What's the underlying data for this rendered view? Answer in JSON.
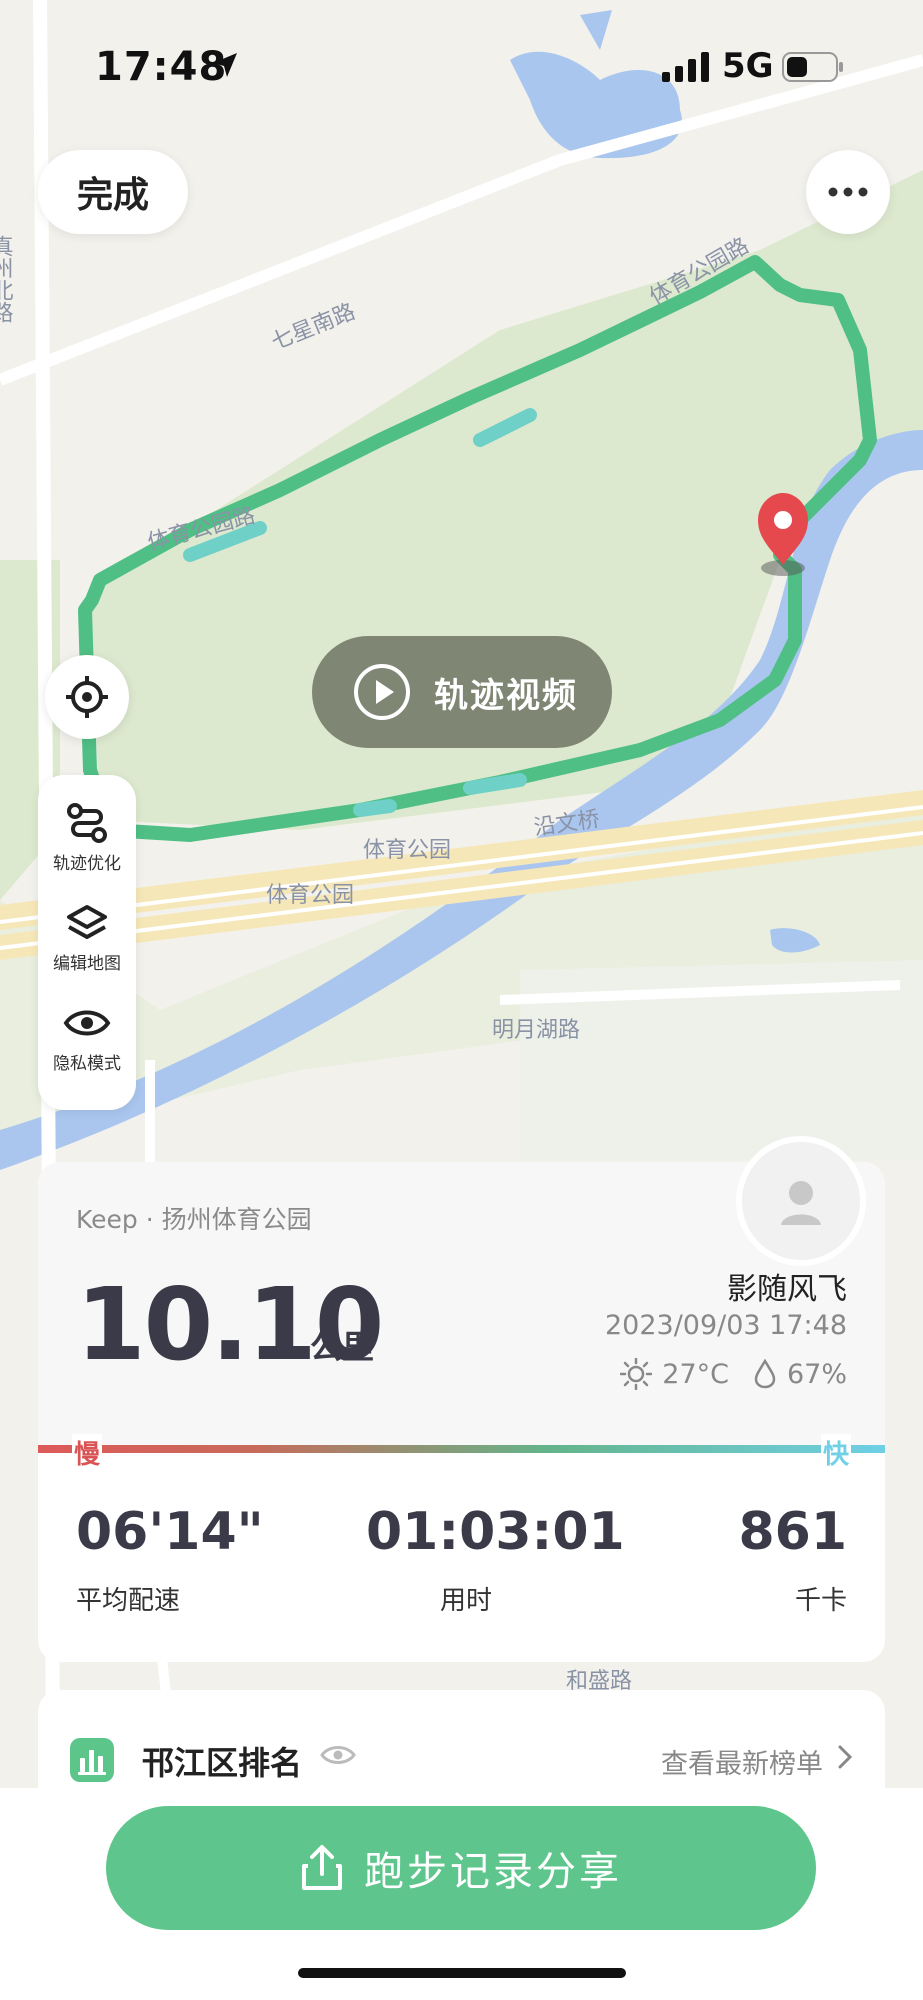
{
  "status_bar": {
    "time": "17:48",
    "network": "5G"
  },
  "top": {
    "done_label": "完成"
  },
  "map": {
    "labels": {
      "zhenzhou_north": "真州北路",
      "qixing_south": "七星南路",
      "tiyu_park_road_1": "体育公园路",
      "tiyu_park_road_2": "体育公园路",
      "tiyu_park_1": "体育公园",
      "tiyu_park_2": "体育公园",
      "yanwen_bridge": "沿文桥",
      "mingyue_lake_road": "明月湖路",
      "hesheng_road": "和盛路"
    }
  },
  "video": {
    "label": "轨迹视频"
  },
  "tools": [
    {
      "label": "轨迹优化",
      "icon": "route-icon"
    },
    {
      "label": "编辑地图",
      "icon": "layers-icon"
    },
    {
      "label": "隐私模式",
      "icon": "eye-icon"
    }
  ],
  "record": {
    "source": "Keep · 扬州体育公园",
    "distance": "10.10",
    "distance_unit": "公里",
    "user_name": "影随风飞",
    "datetime": "2023/09/03 17:48",
    "temperature": "27°C",
    "humidity": "67%",
    "slow_label": "慢",
    "fast_label": "快",
    "stats": [
      {
        "value": "06'14\"",
        "label": "平均配速"
      },
      {
        "value": "01:03:01",
        "label": "用时"
      },
      {
        "value": "861",
        "label": "千卡"
      }
    ]
  },
  "ranking": {
    "title": "邗江区排名",
    "link": "查看最新榜单"
  },
  "share": {
    "label": "跑步记录分享"
  },
  "colors": {
    "route": "#5ec58c",
    "accent": "#5ec58c",
    "slow": "#d95555",
    "fast": "#6fd0e6",
    "pin": "#e5484d"
  }
}
